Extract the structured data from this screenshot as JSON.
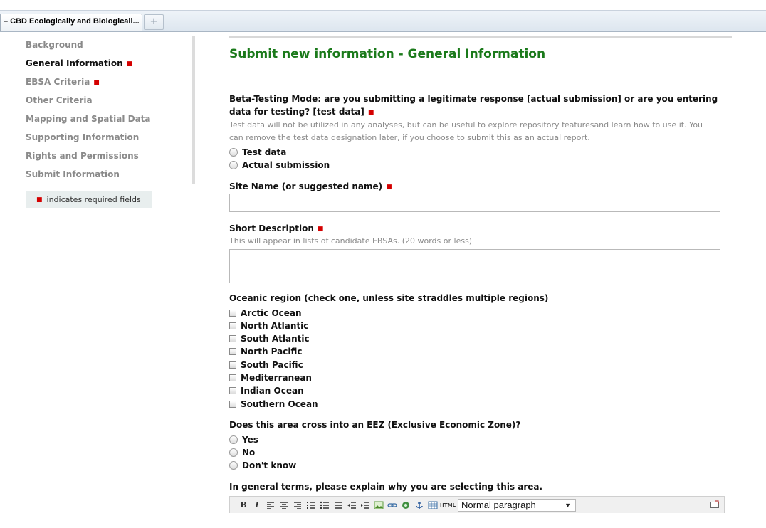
{
  "browser": {
    "tab_title": "– CBD Ecologically and Biologicall...",
    "new_tab_glyph": "+"
  },
  "sidebar": {
    "items": [
      {
        "label": "Background",
        "required": false,
        "active": false
      },
      {
        "label": "General Information",
        "required": true,
        "active": true
      },
      {
        "label": "EBSA Criteria",
        "required": true,
        "active": false
      },
      {
        "label": "Other Criteria",
        "required": false,
        "active": false
      },
      {
        "label": "Mapping and Spatial Data",
        "required": false,
        "active": false
      },
      {
        "label": "Supporting Information",
        "required": false,
        "active": false
      },
      {
        "label": "Rights and Permissions",
        "required": false,
        "active": false
      },
      {
        "label": "Submit Information",
        "required": false,
        "active": false
      }
    ],
    "required_marker": "■",
    "legend_text": "indicates required fields"
  },
  "main": {
    "title": "Submit new information - General Information",
    "beta": {
      "question_line1": "Beta-Testing Mode: are you submitting a legitimate response [actual submission] or are you entering",
      "question_line2": "data for testing? [test data]",
      "help_line1": "Test data will not be utilized in any analyses, but can be useful to explore repository featuresand learn how to use it. You",
      "help_line2": "can remove the test data designation later, if you choose to submit this as an actual report.",
      "options": [
        "Test data",
        "Actual submission"
      ]
    },
    "site_name": {
      "label": "Site Name (or suggested name)",
      "value": ""
    },
    "short_description": {
      "label": "Short Description",
      "help": "This will appear in lists of candidate EBSAs. (20 words or less)",
      "value": ""
    },
    "oceanic_region": {
      "label": "Oceanic region (check one, unless site straddles multiple regions)",
      "options": [
        "Arctic Ocean",
        "North Atlantic",
        "South Atlantic",
        "North Pacific",
        "South Pacific",
        "Mediterranean",
        "Indian Ocean",
        "Southern Ocean"
      ]
    },
    "eez": {
      "label": "Does this area cross into an EEZ (Exclusive Economic Zone)?",
      "options": [
        "Yes",
        "No",
        "Don't know"
      ]
    },
    "explain": {
      "label": "In general terms, please explain why you are selecting this area."
    },
    "editor": {
      "bold": "B",
      "italic": "I",
      "html": "HTML",
      "paragraph_format": "Normal paragraph"
    }
  }
}
